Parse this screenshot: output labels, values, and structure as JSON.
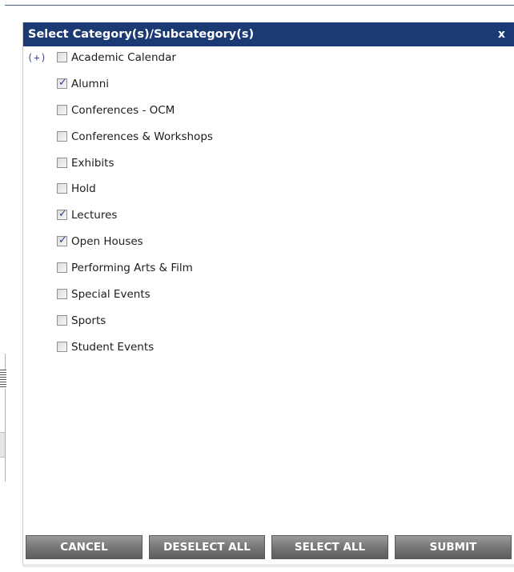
{
  "dialog": {
    "title": "Select Category(s)/Subcategory(s)",
    "close_label": "x"
  },
  "categories": [
    {
      "label": "Academic Calendar",
      "checked": false,
      "expand_toggle": "(+)"
    },
    {
      "label": "Alumni",
      "checked": true
    },
    {
      "label": "Conferences - OCM",
      "checked": false
    },
    {
      "label": "Conferences & Workshops",
      "checked": false
    },
    {
      "label": "Exhibits",
      "checked": false
    },
    {
      "label": "Hold",
      "checked": false
    },
    {
      "label": "Lectures",
      "checked": true
    },
    {
      "label": "Open Houses",
      "checked": true
    },
    {
      "label": "Performing Arts & Film",
      "checked": false
    },
    {
      "label": "Special Events",
      "checked": false
    },
    {
      "label": "Sports",
      "checked": false
    },
    {
      "label": "Student Events",
      "checked": false
    }
  ],
  "buttons": {
    "cancel": "CANCEL",
    "deselect_all": "DESELECT ALL",
    "select_all": "SELECT ALL",
    "submit": "SUBMIT"
  },
  "colors": {
    "header_bg": "#1b3a73",
    "check_color": "#2b3f8f",
    "button_bg": "#7a7a7a"
  },
  "icons": {
    "checkmark": "check-icon",
    "grip": "grip-icon"
  }
}
